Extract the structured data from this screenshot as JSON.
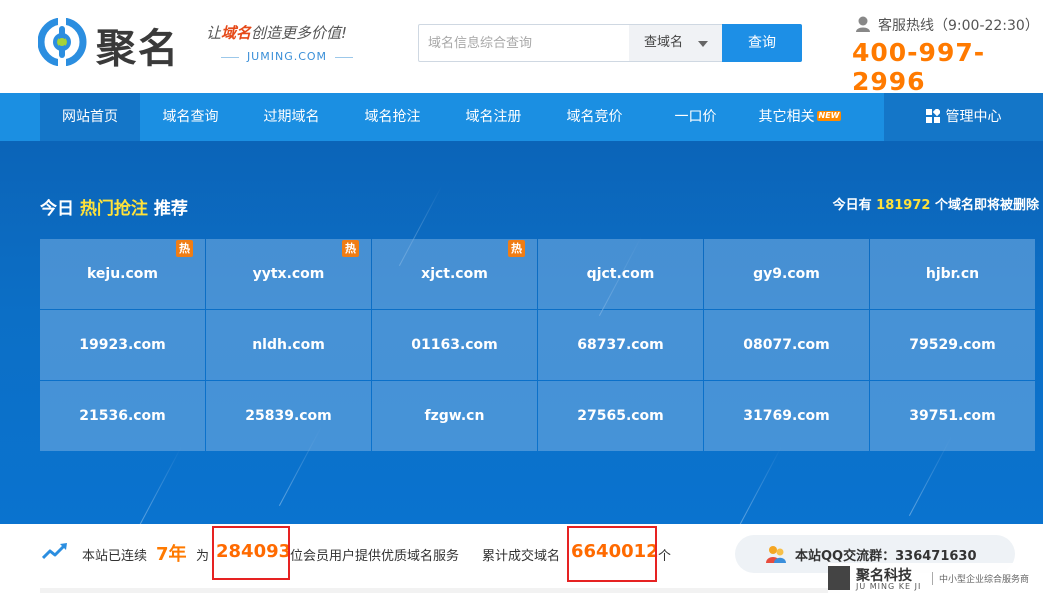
{
  "header": {
    "brand": "聚名",
    "slogan_prefix": "让",
    "slogan_highlight": "域名",
    "slogan_suffix": "创造更多价值!",
    "domain_tag": "JUMING.COM",
    "search": {
      "placeholder": "域名信息综合查询",
      "select_value": "查域名",
      "button": "查询"
    },
    "hotline_label": "客服热线（9:00-22:30）",
    "hotline_number": "400-997-2996"
  },
  "nav": {
    "items": [
      {
        "label": "网站首页",
        "active": true
      },
      {
        "label": "域名查询"
      },
      {
        "label": "过期域名"
      },
      {
        "label": "域名抢注"
      },
      {
        "label": "域名注册"
      },
      {
        "label": "域名竞价"
      },
      {
        "label": "一口价"
      },
      {
        "label": "其它相关"
      }
    ],
    "new_badge": "NEW",
    "manage": "管理中心"
  },
  "hero": {
    "title_prefix": "今日",
    "title_highlight": "热门抢注",
    "title_suffix": "推荐",
    "expire_prefix": "今日有",
    "expire_count": "181972",
    "expire_suffix": "个域名即将被删除",
    "hot_label": "热",
    "domains": [
      {
        "name": "keju.com",
        "hot": true
      },
      {
        "name": "yytx.com",
        "hot": true
      },
      {
        "name": "xjct.com",
        "hot": true
      },
      {
        "name": "qjct.com",
        "hot": false
      },
      {
        "name": "gy9.com",
        "hot": false
      },
      {
        "name": "hjbr.cn",
        "hot": false
      },
      {
        "name": "19923.com",
        "hot": false
      },
      {
        "name": "nldh.com",
        "hot": false
      },
      {
        "name": "01163.com",
        "hot": false
      },
      {
        "name": "68737.com",
        "hot": false
      },
      {
        "name": "08077.com",
        "hot": false
      },
      {
        "name": "79529.com",
        "hot": false
      },
      {
        "name": "21536.com",
        "hot": false
      },
      {
        "name": "25839.com",
        "hot": false
      },
      {
        "name": "fzgw.cn",
        "hot": false
      },
      {
        "name": "27565.com",
        "hot": false
      },
      {
        "name": "31769.com",
        "hot": false
      },
      {
        "name": "39751.com",
        "hot": false
      }
    ]
  },
  "stats": {
    "prefix": "本站已连续",
    "years": "7年",
    "for": "为",
    "members": "284093",
    "members_suffix": "位会员用户提供优质域名服务",
    "deals_prefix": "累计成交域名",
    "deals": "6640012",
    "deals_suffix": "个",
    "qq_text": "本站QQ交流群：336471630"
  },
  "watermark": {
    "title": "聚名科技",
    "subtitle": "JU MING KE JI",
    "slogan": "中小型企业综合服务商"
  },
  "colors": {
    "primary": "#1b8fe2",
    "nav_active": "#1476c8",
    "accent_orange": "#ff7a00",
    "hero_yellow": "#ffe23a",
    "highlight_box": "#e62222"
  }
}
